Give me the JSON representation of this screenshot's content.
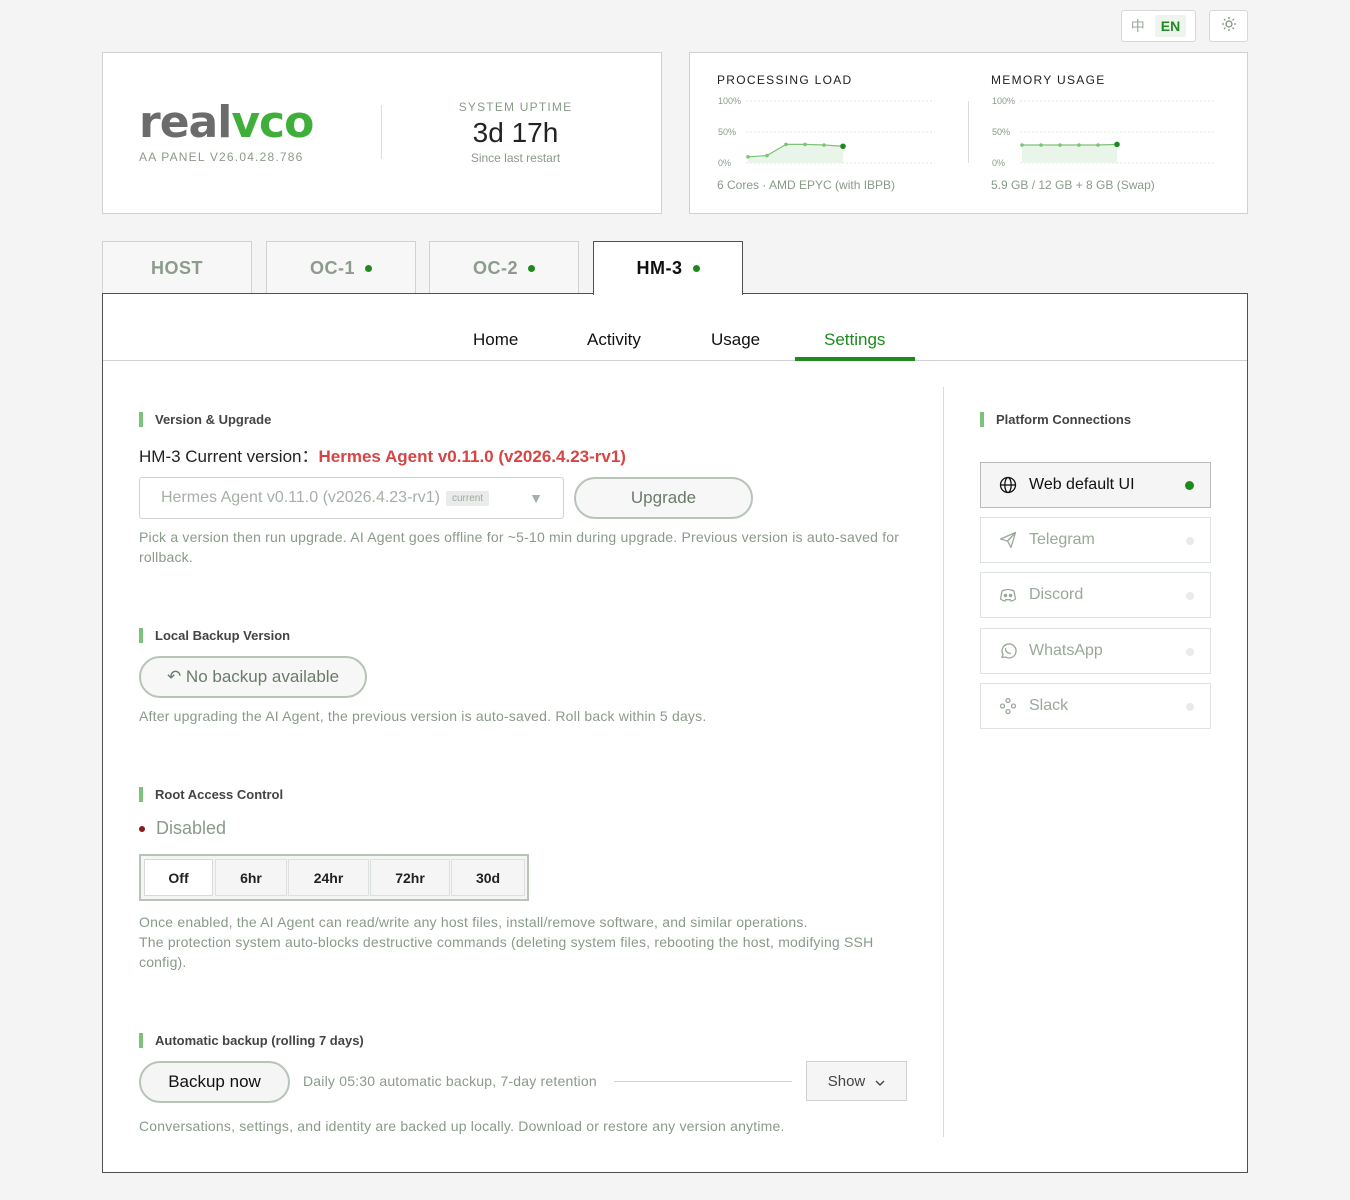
{
  "topbar": {
    "lang_zh": "中",
    "lang_en": "EN",
    "theme_icon": "sun-icon"
  },
  "brand": {
    "logo_part1": "real",
    "logo_part2": "vco",
    "panel_version": "AA PANEL V26.04.28.786",
    "uptime_label": "SYSTEM UPTIME",
    "uptime_value": "3d 17h",
    "uptime_sub": "Since last restart"
  },
  "metrics": {
    "processing": {
      "title": "PROCESSING LOAD",
      "y_ticks": [
        "100%",
        "50%",
        "0%"
      ],
      "values": [
        10,
        12,
        30,
        30,
        29,
        27
      ],
      "sub": "6 Cores · AMD EPYC (with IBPB)"
    },
    "memory": {
      "title": "MEMORY USAGE",
      "y_ticks": [
        "100%",
        "50%",
        "0%"
      ],
      "values": [
        29,
        29,
        29,
        29,
        29,
        30
      ],
      "sub": "5.9 GB / 12 GB + 8 GB (Swap)"
    }
  },
  "host_tabs": [
    {
      "label": "HOST",
      "online": false,
      "active": false
    },
    {
      "label": "OC-1",
      "online": true,
      "active": false
    },
    {
      "label": "OC-2",
      "online": true,
      "active": false
    },
    {
      "label": "HM-3",
      "online": true,
      "active": true
    }
  ],
  "subtabs": [
    {
      "label": "Home"
    },
    {
      "label": "Activity"
    },
    {
      "label": "Usage"
    },
    {
      "label": "Settings",
      "active": true
    }
  ],
  "version_section": {
    "title": "Version & Upgrade",
    "current_label": "HM-3 Current version：",
    "current_value": "Hermes Agent v0.11.0 (v2026.4.23-rv1)",
    "select_value": "Hermes Agent v0.11.0 (v2026.4.23-rv1)",
    "select_badge": "current",
    "upgrade_label": "Upgrade",
    "help_line1": "Pick a version then run upgrade. AI Agent goes offline for ~5-10 min during upgrade. Previous version is auto-saved for",
    "help_line2": "rollback."
  },
  "backup_version_section": {
    "title": "Local Backup Version",
    "button_label": "↶ No backup available",
    "help": "After upgrading the AI Agent, the previous version is auto-saved. Roll back within 5 days."
  },
  "root_section": {
    "title": "Root Access Control",
    "status": "Disabled",
    "options": [
      "Off",
      "6hr",
      "24hr",
      "72hr",
      "30d"
    ],
    "selected": "Off",
    "help_line1": "Once enabled, the AI Agent can read/write any host files, install/remove software, and similar operations.",
    "help_line2": "The protection system auto-blocks destructive commands (deleting system files, rebooting the host, modifying SSH",
    "help_line3": "config)."
  },
  "auto_backup_section": {
    "title": "Automatic backup (rolling 7 days)",
    "button_label": "Backup now",
    "schedule": "Daily 05:30 automatic backup, 7-day retention",
    "show_label": "Show",
    "help": "Conversations, settings, and identity are backed up locally. Download or restore any version anytime."
  },
  "connections": {
    "title": "Platform Connections",
    "items": [
      {
        "label": "Web default UI",
        "icon": "globe-icon",
        "active": true
      },
      {
        "label": "Telegram",
        "icon": "send-icon",
        "active": false
      },
      {
        "label": "Discord",
        "icon": "discord-icon",
        "active": false
      },
      {
        "label": "WhatsApp",
        "icon": "whatsapp-icon",
        "active": false
      },
      {
        "label": "Slack",
        "icon": "slack-icon",
        "active": false
      }
    ]
  },
  "colors": {
    "accent": "#1e8a1e",
    "error": "#d64545",
    "chart_line": "#7cc27a"
  }
}
